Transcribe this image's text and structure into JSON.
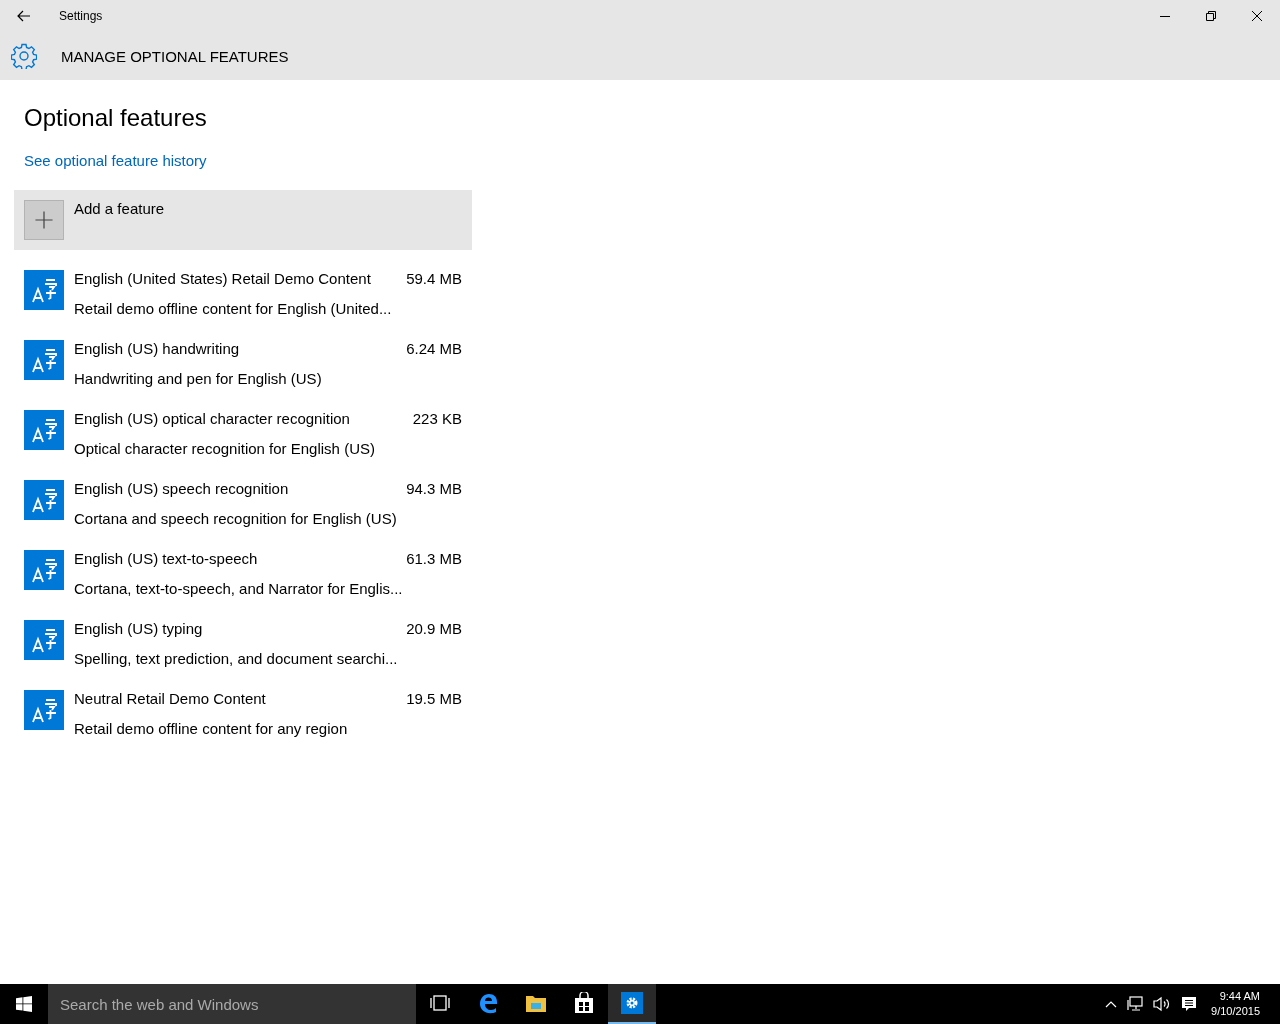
{
  "window": {
    "title": "Settings",
    "header": "MANAGE OPTIONAL FEATURES"
  },
  "page": {
    "heading": "Optional features",
    "history_link": "See optional feature history",
    "add_button": "Add a feature"
  },
  "features": [
    {
      "name": "English (United States) Retail Demo Content",
      "size": "59.4 MB",
      "description": "Retail demo offline content for English (United..."
    },
    {
      "name": "English (US) handwriting",
      "size": "6.24 MB",
      "description": "Handwriting and pen for English (US)"
    },
    {
      "name": "English (US) optical character recognition",
      "size": "223 KB",
      "description": "Optical character recognition for English (US)"
    },
    {
      "name": "English (US) speech recognition",
      "size": "94.3 MB",
      "description": "Cortana and speech recognition for English (US)"
    },
    {
      "name": "English (US) text-to-speech",
      "size": "61.3 MB",
      "description": "Cortana, text-to-speech, and Narrator for Englis..."
    },
    {
      "name": "English (US) typing",
      "size": "20.9 MB",
      "description": "Spelling, text prediction, and document searchi..."
    },
    {
      "name": "Neutral Retail Demo Content",
      "size": "19.5 MB",
      "description": "Retail demo offline content for any region"
    }
  ],
  "taskbar": {
    "search_placeholder": "Search the web and Windows",
    "apps": [
      {
        "kind": "taskview",
        "selected": false
      },
      {
        "kind": "edge",
        "selected": false
      },
      {
        "kind": "explorer",
        "selected": false
      },
      {
        "kind": "store",
        "selected": false
      },
      {
        "kind": "settings",
        "selected": true
      }
    ],
    "time": "9:44 AM",
    "date": "9/10/2015"
  }
}
